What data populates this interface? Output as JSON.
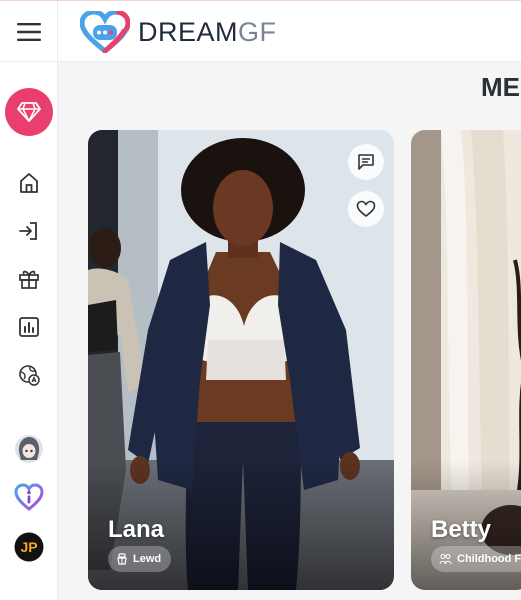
{
  "header": {
    "logo_primary": "DREAM",
    "logo_secondary": "GF"
  },
  "main": {
    "section_title": "ME"
  },
  "cards": [
    {
      "name": "Lana",
      "tag": "Lewd",
      "tag_icon": "maid-icon"
    },
    {
      "name": "Betty",
      "tag": "Childhood F",
      "tag_icon": "friends-icon"
    }
  ],
  "sidebar": {
    "items": [
      "premium-diamond",
      "home",
      "login",
      "gift",
      "stats",
      "language",
      "avatar-anime",
      "avatar-info",
      "avatar-jp"
    ],
    "jp_badge": "JP"
  },
  "colors": {
    "accent": "#e83f6f",
    "logo_blue": "#4aa3e8",
    "logo_pink": "#e8406f"
  }
}
